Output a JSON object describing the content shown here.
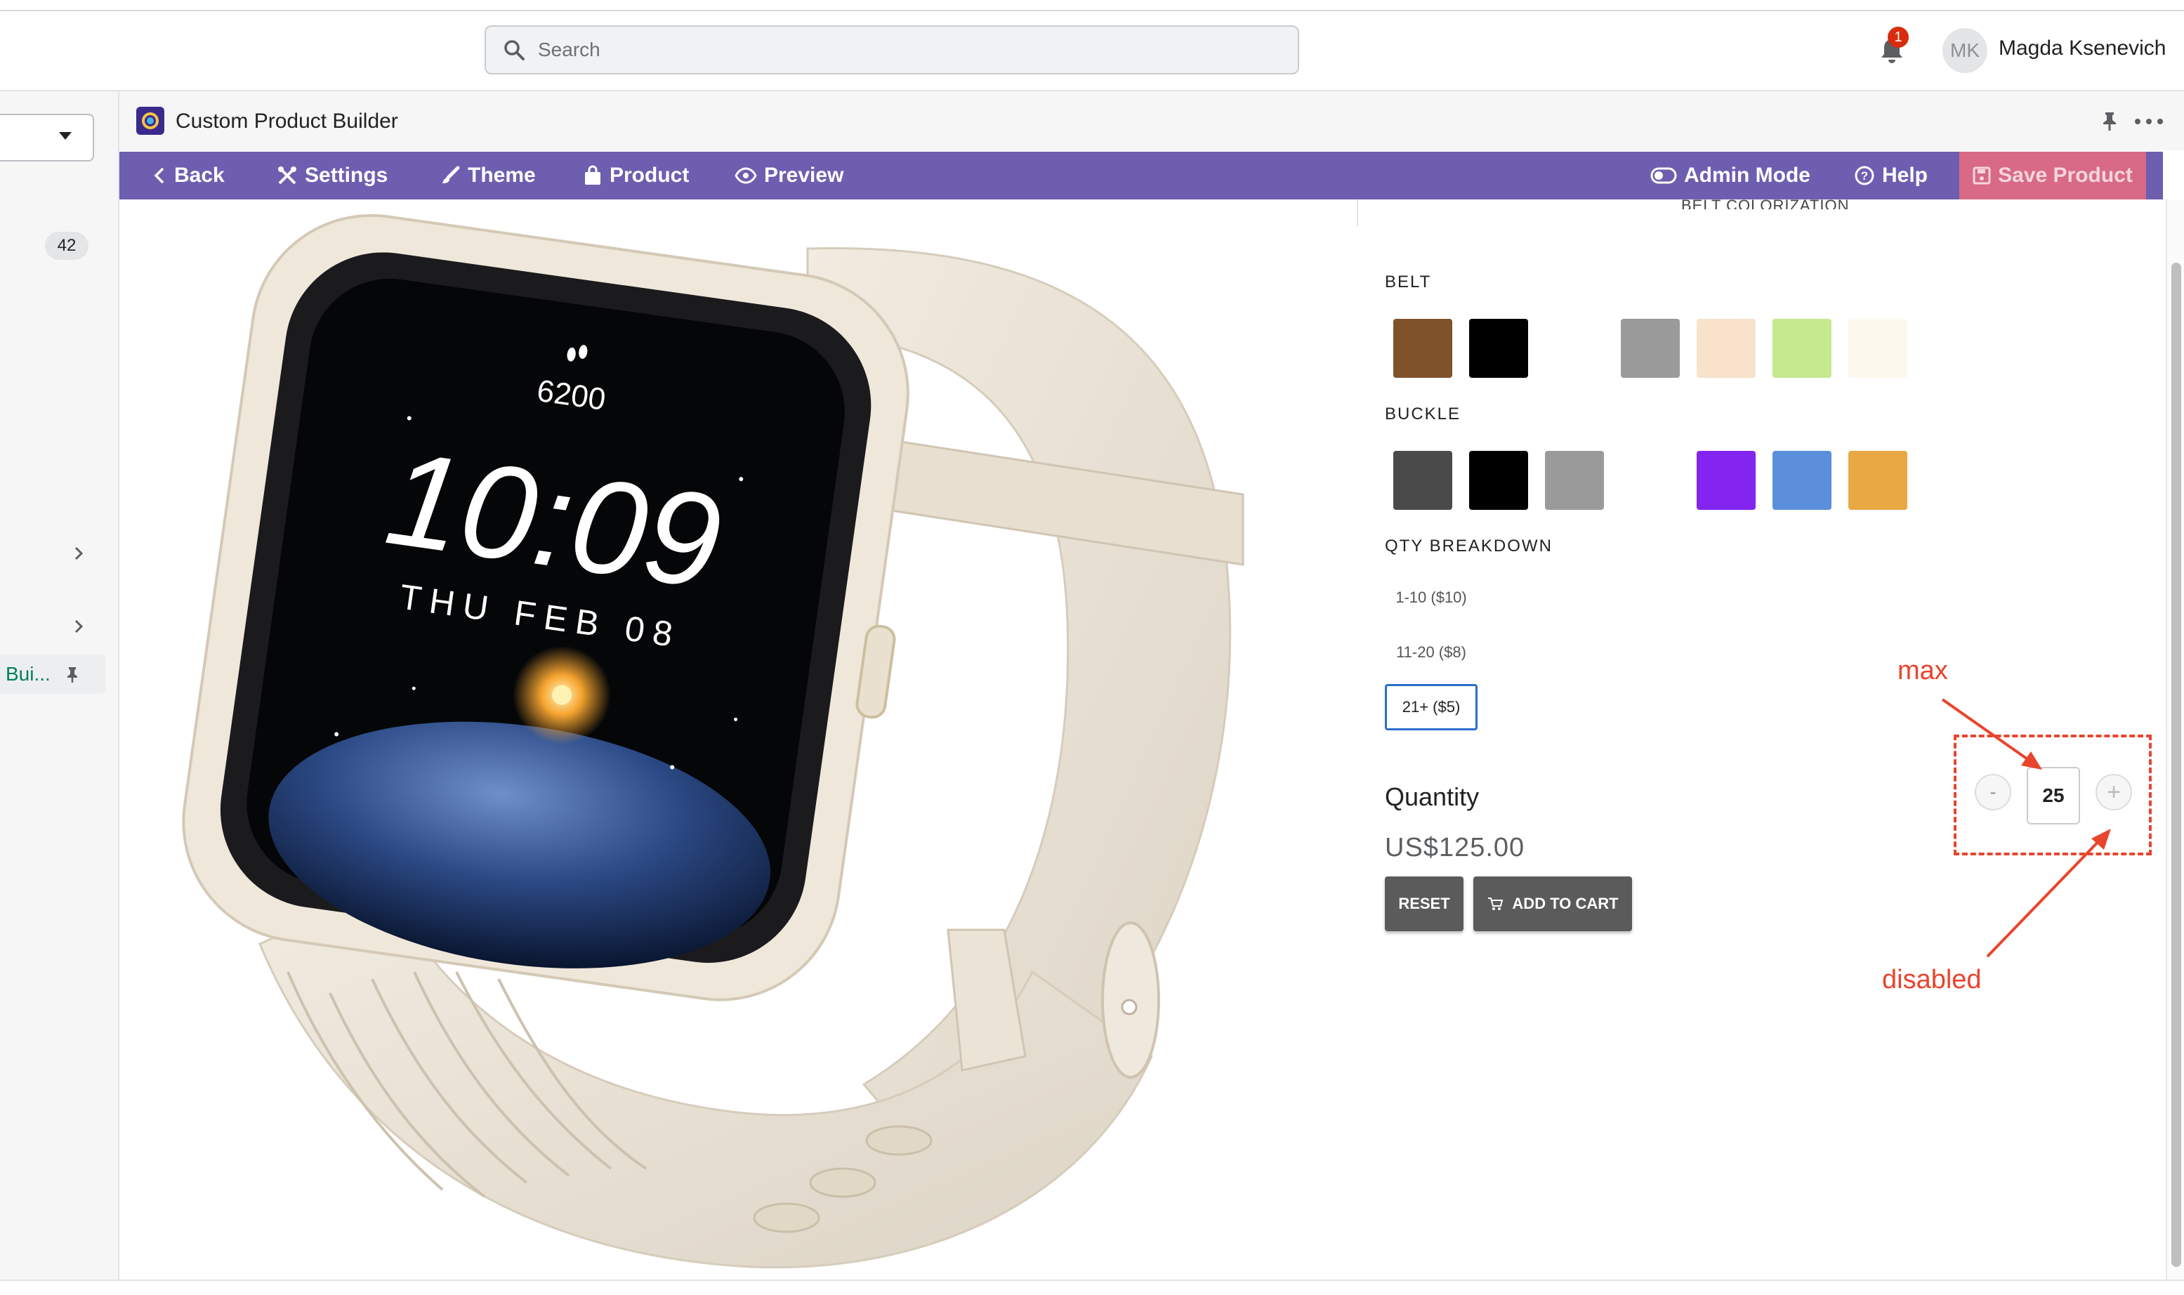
{
  "topbar": {
    "search_placeholder": "Search",
    "notification_count": "1",
    "user_initials": "MK",
    "user_name": "Magda Ksenevich"
  },
  "sidebar": {
    "count_badge": "42",
    "active_item_label": "Bui..."
  },
  "app": {
    "title": "Custom Product Builder"
  },
  "nav": {
    "back": "Back",
    "settings": "Settings",
    "theme": "Theme",
    "product": "Product",
    "preview": "Preview",
    "admin_mode": "Admin Mode",
    "help": "Help",
    "save_product": "Save Product"
  },
  "watch": {
    "steps": "6200",
    "time": "10:09",
    "date": "THU FEB 08"
  },
  "configurator": {
    "cut_header": "BELT COLORIZATION",
    "belt_label": "BELT",
    "belt_colors": [
      "#7f522c",
      "#000000",
      "#ffffff",
      "#9a9a9a",
      "#f8e2cc",
      "#c4e98e",
      "#fdf8ee"
    ],
    "buckle_label": "BUCKLE",
    "buckle_colors": [
      "#4a4a4a",
      "#000000",
      "#9a9a9a",
      "#ffffff",
      "#8324ef",
      "#5b8fdc",
      "#e9a843"
    ],
    "qty_breakdown_label": "QTY BREAKDOWN",
    "qty_options": [
      "1-10 ($10)",
      "11-20 ($8)",
      "21+ ($5)"
    ],
    "qty_selected_index": 2,
    "quantity_label": "Quantity",
    "quantity_value": "25",
    "stepper_minus": "-",
    "stepper_plus": "+",
    "price": "US$125.00",
    "reset_label": "RESET",
    "add_to_cart_label": "ADD TO CART"
  },
  "annotations": {
    "max_label": "max",
    "disabled_label": "disabled",
    "color": "#e8452c"
  },
  "colors": {
    "nav_bg": "#6e5eb0",
    "save_bg": "#d86a86",
    "accent_blue": "#2c6ecb"
  }
}
